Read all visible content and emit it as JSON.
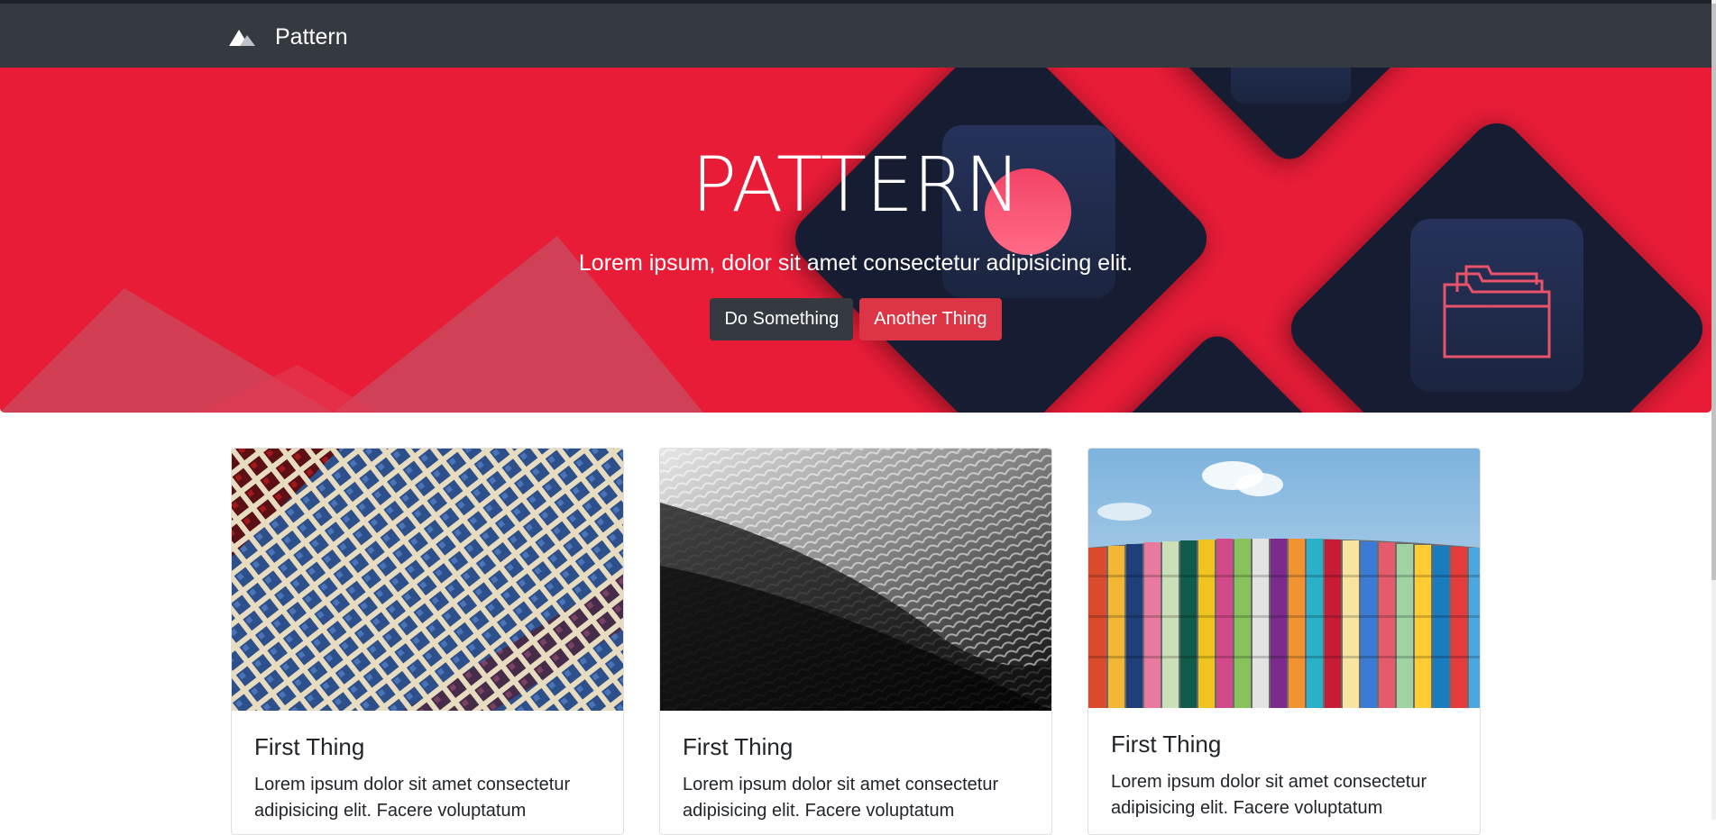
{
  "navbar": {
    "brand": "Pattern",
    "logo_icon": "mountain-icon"
  },
  "hero": {
    "title": "PATTERN",
    "subtitle": "Lorem ipsum, dolor sit amet consectetur adipisicing elit.",
    "primary_button": "Do Something",
    "secondary_button": "Another Thing",
    "folder_icon": "folder-icon",
    "colors": {
      "background": "#e91c38",
      "dark_tile": "#121e31",
      "button_dark": "#343a40",
      "button_red": "#dc3545"
    }
  },
  "cards": [
    {
      "title": "First Thing",
      "text": "Lorem ipsum dolor sit amet consectetur adipisicing elit. Facere voluptatum"
    },
    {
      "title": "First Thing",
      "text": "Lorem ipsum dolor sit amet consectetur adipisicing elit. Facere voluptatum"
    },
    {
      "title": "First Thing",
      "text": "Lorem ipsum dolor sit amet consectetur adipisicing elit. Facere voluptatum"
    }
  ]
}
